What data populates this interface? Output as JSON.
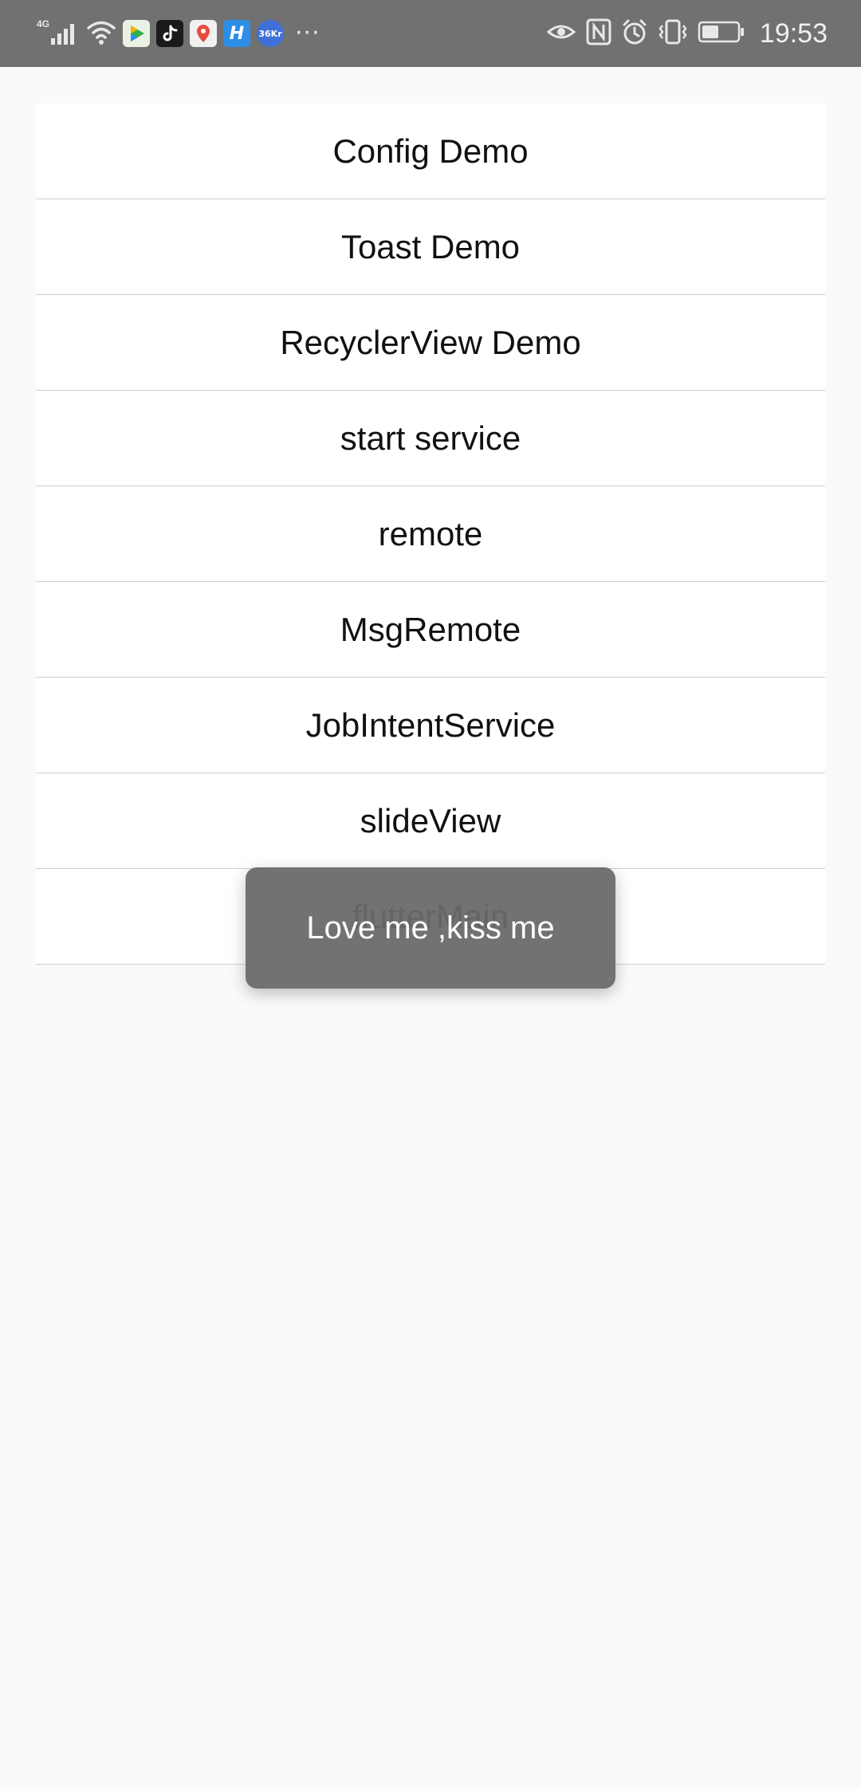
{
  "status_bar": {
    "network_type": "4G",
    "time": "19:53",
    "left_icons": [
      "signal-icon",
      "wifi-icon",
      "video-app-icon",
      "tiktok-app-icon",
      "map-app-icon",
      "h-app-icon",
      "36kr-app-icon"
    ],
    "h_app_label": "H",
    "kr_app_label": "36Kr",
    "more": "···",
    "right_icons": [
      "eye-comfort-icon",
      "nfc-icon",
      "alarm-icon",
      "vibrate-icon",
      "battery-icon"
    ]
  },
  "menu": {
    "items": [
      {
        "label": "Config Demo"
      },
      {
        "label": "Toast Demo"
      },
      {
        "label": "RecyclerView Demo"
      },
      {
        "label": "start service"
      },
      {
        "label": "remote"
      },
      {
        "label": "MsgRemote"
      },
      {
        "label": "JobIntentService"
      },
      {
        "label": "slideView"
      },
      {
        "label": "flutterMain"
      }
    ]
  },
  "toast": {
    "message": "Love me ,kiss me"
  }
}
